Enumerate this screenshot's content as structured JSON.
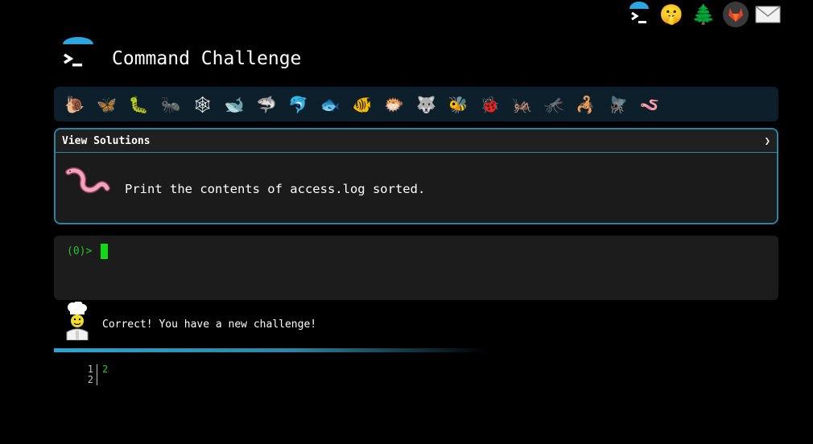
{
  "topnav": {
    "items": [
      {
        "icon": "terminal-umbrella-icon",
        "glyph": "❯"
      },
      {
        "icon": "shushing-face-icon",
        "glyph": "🤫"
      },
      {
        "icon": "evergreen-tree-icon",
        "glyph": "🌲"
      },
      {
        "icon": "gitlab-icon",
        "glyph": "🦊"
      },
      {
        "icon": "envelope-icon",
        "glyph": "✉"
      }
    ]
  },
  "header": {
    "title": "Command Challenge"
  },
  "critters": [
    {
      "icon": "snail-icon",
      "glyph": "🐌"
    },
    {
      "icon": "butterfly-icon",
      "glyph": "🦋"
    },
    {
      "icon": "caterpillar-icon",
      "glyph": "🐛"
    },
    {
      "icon": "ant-icon",
      "glyph": "🐜"
    },
    {
      "icon": "spider-web-icon",
      "glyph": "🕸"
    },
    {
      "icon": "whale-icon",
      "glyph": "🐋"
    },
    {
      "icon": "shark-icon",
      "glyph": "🦈"
    },
    {
      "icon": "dolphin-icon",
      "glyph": "🐬"
    },
    {
      "icon": "fish-icon",
      "glyph": "🐟"
    },
    {
      "icon": "tropical-fish-icon",
      "glyph": "🐠"
    },
    {
      "icon": "blowfish-icon",
      "glyph": "🐡"
    },
    {
      "icon": "wolf-icon",
      "glyph": "🐺"
    },
    {
      "icon": "bee-icon",
      "glyph": "🐝"
    },
    {
      "icon": "ladybug-icon",
      "glyph": "🐞"
    },
    {
      "icon": "cricket-icon",
      "glyph": "🦗"
    },
    {
      "icon": "mosquito-icon",
      "glyph": "🦟"
    },
    {
      "icon": "scorpion-icon",
      "glyph": "🦂"
    },
    {
      "icon": "fly-icon",
      "glyph": "🪰"
    },
    {
      "icon": "worm-icon",
      "glyph": "🪱"
    }
  ],
  "challenge": {
    "solutions_label": "View Solutions",
    "toggle_arrow": "❯",
    "icon": "worm-icon",
    "text": "Print the contents of access.log sorted."
  },
  "terminal": {
    "prompt": "(0)>"
  },
  "feedback": {
    "icon": "chef-icon",
    "text": "Correct! You have a new challenge!"
  },
  "output": {
    "line_numbers": [
      "1",
      "2"
    ],
    "lines": [
      "2",
      ""
    ]
  },
  "colors": {
    "background": "#000000",
    "accent": "#2a86a4",
    "prompt_green": "#27c52a",
    "cursor_green": "#16d916",
    "critter_bar": "#0d1f2a"
  }
}
